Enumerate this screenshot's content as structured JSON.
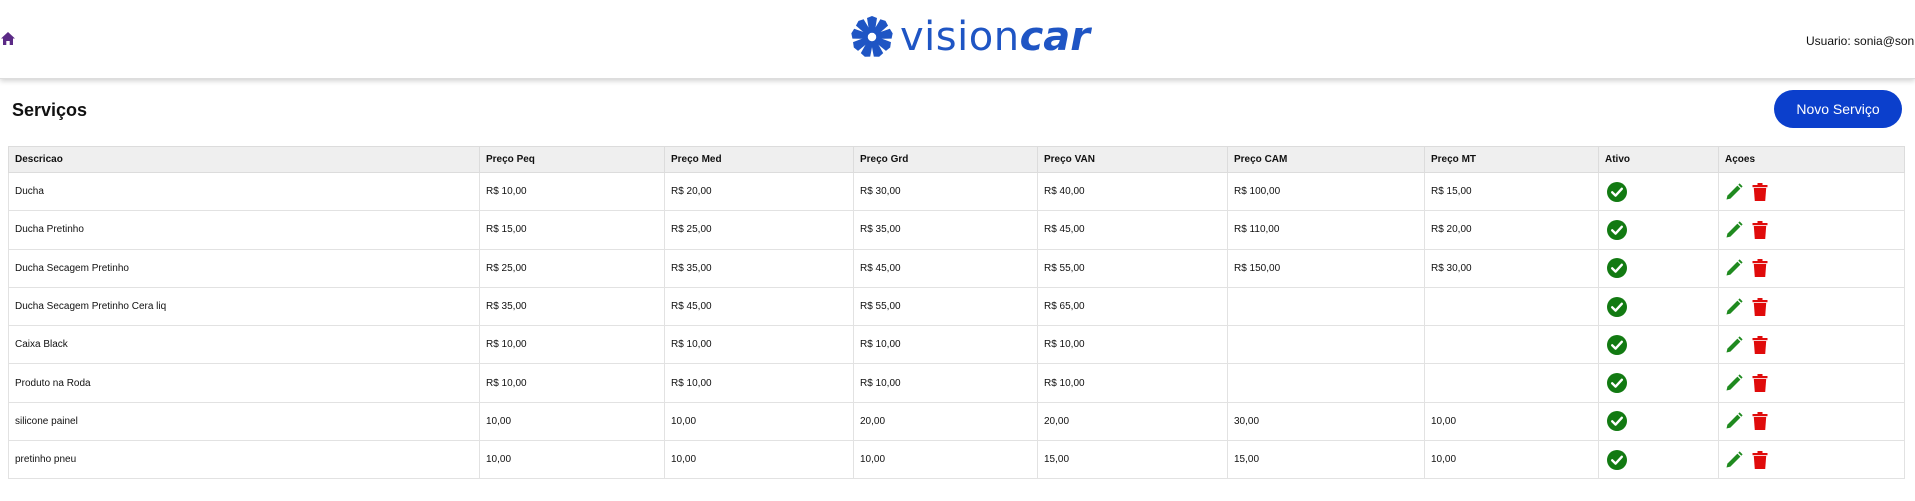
{
  "header": {
    "logo_part1": "vision",
    "logo_part2": "car",
    "user_label": "Usuario: sonia@sonia"
  },
  "page": {
    "title": "Serviços",
    "new_button_label": "Novo Serviço"
  },
  "table": {
    "columns": [
      "Descricao",
      "Preço Peq",
      "Preço Med",
      "Preço Grd",
      "Preço VAN",
      "Preço CAM",
      "Preço MT",
      "Ativo",
      "Açoes"
    ],
    "rows": [
      {
        "descricao": "Ducha",
        "peq": "R$ 10,00",
        "med": "R$ 20,00",
        "grd": "R$ 30,00",
        "van": "R$ 40,00",
        "cam": "R$ 100,00",
        "mt": "R$ 15,00"
      },
      {
        "descricao": "Ducha Pretinho",
        "peq": "R$ 15,00",
        "med": "R$ 25,00",
        "grd": "R$ 35,00",
        "van": "R$ 45,00",
        "cam": "R$ 110,00",
        "mt": "R$ 20,00"
      },
      {
        "descricao": "Ducha Secagem Pretinho",
        "peq": "R$ 25,00",
        "med": "R$ 35,00",
        "grd": "R$ 45,00",
        "van": "R$ 55,00",
        "cam": "R$ 150,00",
        "mt": "R$ 30,00"
      },
      {
        "descricao": "Ducha Secagem Pretinho Cera liq",
        "peq": "R$ 35,00",
        "med": "R$ 45,00",
        "grd": "R$ 55,00",
        "van": "R$ 65,00",
        "cam": "",
        "mt": ""
      },
      {
        "descricao": "Caixa Black",
        "peq": "R$ 10,00",
        "med": "R$ 10,00",
        "grd": "R$ 10,00",
        "van": "R$ 10,00",
        "cam": "",
        "mt": ""
      },
      {
        "descricao": "Produto na Roda",
        "peq": "R$ 10,00",
        "med": "R$ 10,00",
        "grd": "R$ 10,00",
        "van": "R$ 10,00",
        "cam": "",
        "mt": ""
      },
      {
        "descricao": "silicone painel",
        "peq": "10,00",
        "med": "10,00",
        "grd": "20,00",
        "van": "20,00",
        "cam": "30,00",
        "mt": "10,00"
      },
      {
        "descricao": "pretinho pneu",
        "peq": "10,00",
        "med": "10,00",
        "grd": "10,00",
        "van": "15,00",
        "cam": "15,00",
        "mt": "10,00"
      }
    ]
  },
  "icons": {
    "home": "home-icon",
    "active": "check-circle-icon",
    "edit": "pencil-icon",
    "delete": "trash-icon"
  },
  "colors": {
    "brand": "#1f55c4",
    "home_icon": "#5b2a86",
    "button": "#0b3fcc",
    "active_icon": "#127a12",
    "edit_icon": "#1f8a1f",
    "delete_icon": "#e00b0b"
  }
}
